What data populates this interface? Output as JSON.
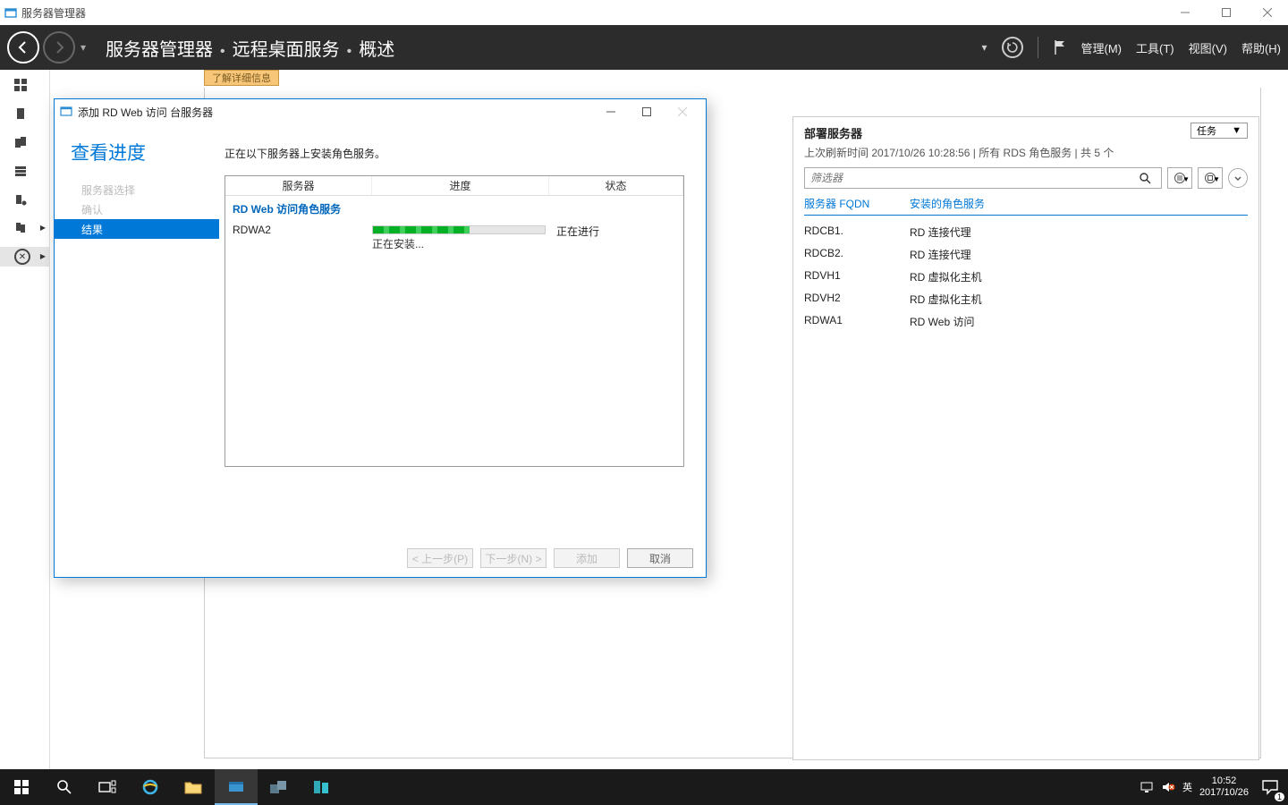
{
  "titlebar": {
    "title": "服务器管理器"
  },
  "header": {
    "crumb1": "服务器管理器",
    "crumb2": "远程桌面服务",
    "crumb3": "概述",
    "menu": {
      "manage": "管理(M)",
      "tools": "工具(T)",
      "view": "视图(V)",
      "help": "帮助(H)"
    }
  },
  "banner": {
    "text": "了解详细信息"
  },
  "dialog": {
    "title": "添加 RD Web 访问 台服务器",
    "heading": "查看进度",
    "steps": {
      "s1": "服务器选择",
      "s2": "确认",
      "s3": "结果"
    },
    "desc": "正在以下服务器上安装角色服务。",
    "columns": {
      "server": "服务器",
      "progress": "进度",
      "status": "状态"
    },
    "section": "RD Web 访问角色服务",
    "row": {
      "server": "RDWA2",
      "status": "正在进行",
      "installing": "正在安装..."
    },
    "buttons": {
      "prev": "< 上一步(P)",
      "next": "下一步(N) >",
      "add": "添加",
      "cancel": "取消"
    }
  },
  "deploy": {
    "title": "部署服务器",
    "subtitle": "上次刷新时间 2017/10/26 10:28:56 | 所有 RDS 角色服务  | 共 5 个",
    "task_label": "任务",
    "filter_placeholder": "筛选器",
    "columns": {
      "fqdn": "服务器 FQDN",
      "role": "安装的角色服务"
    },
    "rows": [
      {
        "fqdn": "RDCB1.",
        "role": "RD 连接代理"
      },
      {
        "fqdn": "RDCB2.",
        "role": "RD 连接代理"
      },
      {
        "fqdn": "RDVH1",
        "role": "RD 虚拟化主机"
      },
      {
        "fqdn": "RDVH2",
        "role": "RD 虚拟化主机"
      },
      {
        "fqdn": "RDWA1",
        "role": "RD Web 访问"
      }
    ]
  },
  "taskbar": {
    "ime": "英",
    "time": "10:52",
    "date": "2017/10/26",
    "notif_count": "1"
  }
}
